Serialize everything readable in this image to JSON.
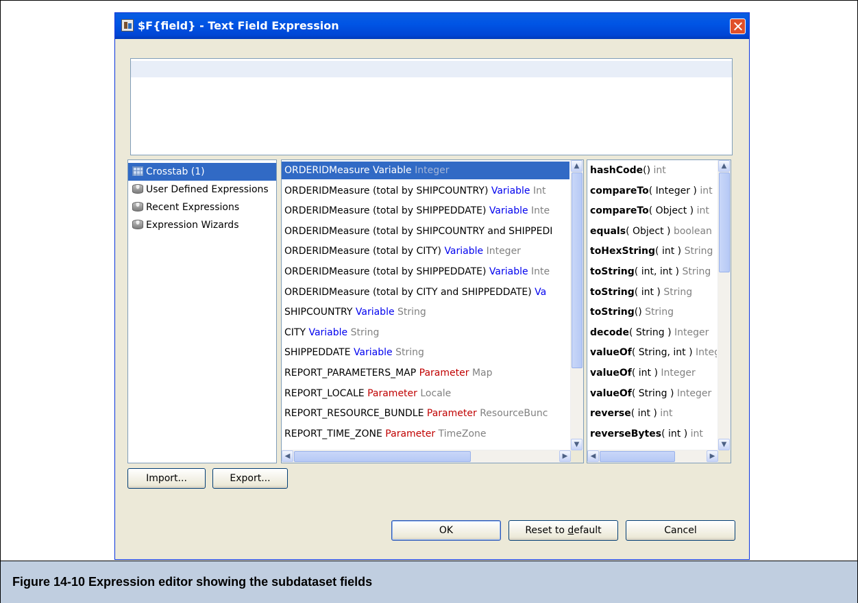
{
  "dialog": {
    "title": "$F{field} - Text Field Expression",
    "expression_text": ""
  },
  "categories": [
    {
      "label": "Crosstab (1)",
      "icon": "crosstab-grid-icon",
      "selected": true
    },
    {
      "label": "User Defined Expressions",
      "icon": "database-icon",
      "selected": false
    },
    {
      "label": "Recent Expressions",
      "icon": "database-icon",
      "selected": false
    },
    {
      "label": "Expression Wizards",
      "icon": "database-icon",
      "selected": false
    }
  ],
  "objects": [
    {
      "name": "ORDERIDMeasure",
      "kind": "Variable",
      "type": "Integer",
      "selected": true
    },
    {
      "name": "ORDERIDMeasure (total by SHIPCOUNTRY)",
      "kind": "Variable",
      "type": "Int"
    },
    {
      "name": "ORDERIDMeasure (total by SHIPPEDDATE)",
      "kind": "Variable",
      "type": "Inte"
    },
    {
      "name": "ORDERIDMeasure (total by SHIPCOUNTRY and SHIPPEDI",
      "kind": "",
      "type": ""
    },
    {
      "name": "ORDERIDMeasure (total by CITY)",
      "kind": "Variable",
      "type": "Integer"
    },
    {
      "name": "ORDERIDMeasure (total by SHIPPEDDATE)",
      "kind": "Variable",
      "type": "Inte"
    },
    {
      "name": "ORDERIDMeasure (total by CITY and SHIPPEDDATE)",
      "kind": "Va",
      "type": ""
    },
    {
      "name": "SHIPCOUNTRY",
      "kind": "Variable",
      "type": "String"
    },
    {
      "name": "CITY",
      "kind": "Variable",
      "type": "String"
    },
    {
      "name": "SHIPPEDDATE",
      "kind": "Variable",
      "type": "String"
    },
    {
      "name": "REPORT_PARAMETERS_MAP",
      "kind": "Parameter",
      "type": "Map"
    },
    {
      "name": "REPORT_LOCALE",
      "kind": "Parameter",
      "type": "Locale"
    },
    {
      "name": "REPORT_RESOURCE_BUNDLE",
      "kind": "Parameter",
      "type": "ResourceBunc"
    },
    {
      "name": "REPORT_TIME_ZONE",
      "kind": "Parameter",
      "type": "TimeZone"
    }
  ],
  "methods": [
    {
      "name": "hashCode",
      "args": "()",
      "ret": "int"
    },
    {
      "name": "compareTo",
      "args": "( Integer )",
      "ret": "int"
    },
    {
      "name": "compareTo",
      "args": "( Object )",
      "ret": "int"
    },
    {
      "name": "equals",
      "args": "( Object )",
      "ret": "boolean"
    },
    {
      "name": "toHexString",
      "args": "( int )",
      "ret": "String"
    },
    {
      "name": "toString",
      "args": "( int, int )",
      "ret": "String"
    },
    {
      "name": "toString",
      "args": "( int )",
      "ret": "String"
    },
    {
      "name": "toString",
      "args": "()",
      "ret": "String"
    },
    {
      "name": "decode",
      "args": "( String )",
      "ret": "Integer"
    },
    {
      "name": "valueOf",
      "args": "( String, int )",
      "ret": "Integer"
    },
    {
      "name": "valueOf",
      "args": "( int )",
      "ret": "Integer"
    },
    {
      "name": "valueOf",
      "args": "( String )",
      "ret": "Integer"
    },
    {
      "name": "reverse",
      "args": "( int )",
      "ret": "int"
    },
    {
      "name": "reverseBytes",
      "args": "( int )",
      "ret": "int"
    }
  ],
  "buttons": {
    "import": "Import...",
    "export": "Export...",
    "ok": "OK",
    "reset_prefix": "Reset to ",
    "reset_mnemonic": "d",
    "reset_suffix": "efault",
    "cancel": "Cancel"
  },
  "caption": "Figure 14-10  Expression editor showing the subdataset fields",
  "colors": {
    "selection": "#316ac5",
    "variable_kind": "#0000ee",
    "parameter_kind": "#c00000",
    "type_text": "#808080",
    "titlebar": "#0055e5",
    "caption_band": "#c0cee0"
  }
}
